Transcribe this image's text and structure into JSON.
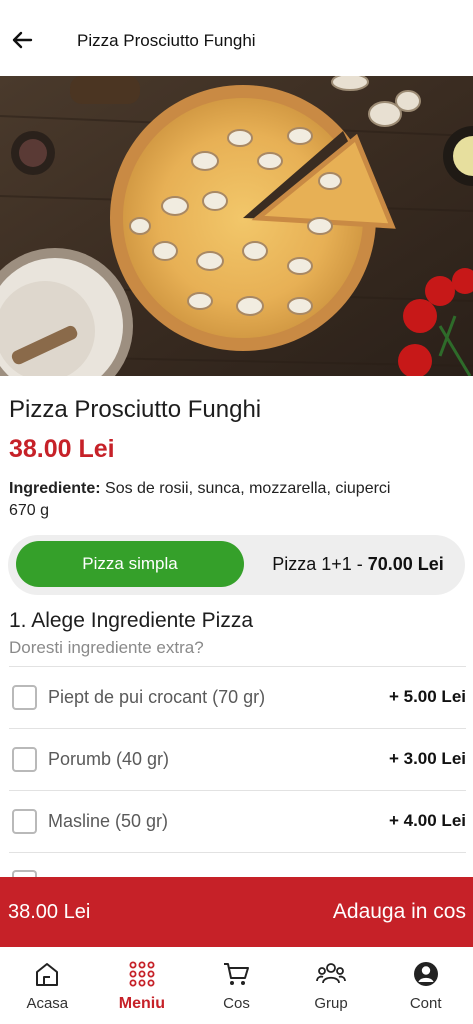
{
  "header": {
    "title": "Pizza Prosciutto Funghi",
    "back_icon": "arrow-left-icon"
  },
  "product": {
    "name": "Pizza Prosciutto Funghi",
    "price": "38.00 Lei",
    "ingredients_label": "Ingrediente:",
    "ingredients_text": "Sos de rosii, sunca, mozzarella, ciuperci",
    "weight": "670 g"
  },
  "variant_toggle": {
    "selected": "Pizza simpla",
    "other_prefix": "Pizza 1+1 - ",
    "other_price": "70.00 Lei"
  },
  "extras": {
    "title": "1. Alege Ingrediente Pizza",
    "subtitle": "Doresti ingrediente extra?",
    "options": [
      {
        "label": "Piept de pui crocant (70 gr)",
        "price": "+ 5.00 Lei",
        "checked": false
      },
      {
        "label": "Porumb (40 gr)",
        "price": "+ 3.00 Lei",
        "checked": false
      },
      {
        "label": "Masline (50 gr)",
        "price": "+ 4.00 Lei",
        "checked": false
      }
    ]
  },
  "cart_bar": {
    "total": "38.00 Lei",
    "action": "Adauga in cos"
  },
  "nav": {
    "items": [
      {
        "label": "Acasa",
        "icon": "home-icon"
      },
      {
        "label": "Meniu",
        "icon": "menu-grid-icon",
        "active": true
      },
      {
        "label": "Cos",
        "icon": "cart-icon"
      },
      {
        "label": "Grup",
        "icon": "group-icon"
      },
      {
        "label": "Cont",
        "icon": "account-icon"
      }
    ]
  },
  "colors": {
    "brand_red": "#c62128",
    "green": "#35a02a"
  }
}
